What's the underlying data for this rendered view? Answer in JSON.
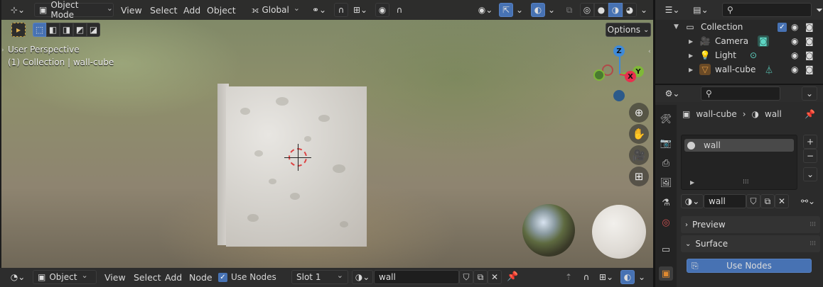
{
  "viewport": {
    "editor_icon": "axes-editor-icon",
    "mode": "Object Mode",
    "menus": [
      "View",
      "Select",
      "Add",
      "Object"
    ],
    "transform_orientation": "Global",
    "options_label": "Options",
    "overlay_line1": "User Perspective",
    "overlay_line2": "(1) Collection | wall-cube",
    "gizmo_axes": {
      "z": "Z",
      "y": "Y",
      "x": "X"
    }
  },
  "bottom_bar": {
    "editor_type": "Object",
    "menus": [
      "View",
      "Select",
      "Add",
      "Node"
    ],
    "use_nodes_label": "Use Nodes",
    "slot": "Slot 1",
    "material": "wall"
  },
  "outliner": {
    "collection_label": "Collection",
    "items": [
      {
        "label": "Camera"
      },
      {
        "label": "Light"
      },
      {
        "label": "wall-cube"
      }
    ]
  },
  "properties": {
    "breadcrumb_object": "wall-cube",
    "breadcrumb_material": "wall",
    "slot_item": "wall",
    "material_field": "wall",
    "panels": {
      "preview": "Preview",
      "surface": "Surface"
    },
    "use_nodes_button": "Use Nodes"
  },
  "colors": {
    "accent": "#4772b3",
    "x_axis": "#e8304e",
    "y_axis": "#7fb838",
    "z_axis": "#3f8ad8"
  }
}
